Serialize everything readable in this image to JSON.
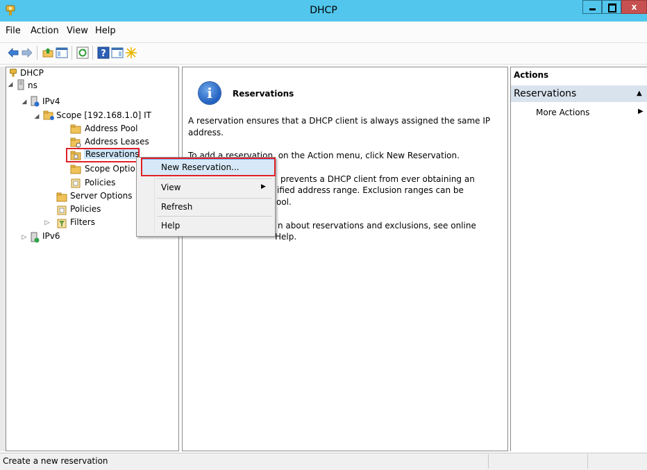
{
  "window": {
    "title": "DHCP"
  },
  "menubar": {
    "items": [
      "File",
      "Action",
      "View",
      "Help"
    ]
  },
  "tree": {
    "root": "DHCP",
    "server": "ns",
    "ipv4": "IPv4",
    "scope": "Scope [192.168.1.0] IT",
    "address_pool": "Address Pool",
    "address_leases": "Address Leases",
    "reservations": "Reservations",
    "scope_options": "Scope Optio",
    "scope_policies": "Policies",
    "server_options": "Server Options",
    "policies": "Policies",
    "filters": "Filters",
    "ipv6": "IPv6"
  },
  "context_menu": {
    "items": [
      "New Reservation...",
      "View",
      "Refresh",
      "Help"
    ]
  },
  "result": {
    "heading": "Reservations",
    "p1_line1": "A reservation ensures that a DHCP client is always assigned the same IP",
    "p1_line2": "address.",
    "p2_line1": "To add a reservation, on the Action menu, click New Reservation.",
    "p3_line1": "prevents a DHCP client from ever obtaining an",
    "p3_line2": "ified address range.  Exclusion ranges can be",
    "p3_line3": "ool.",
    "p4_line1": "n about reservations and exclusions, see online",
    "p4_line2": "Help."
  },
  "actions": {
    "header": "Actions",
    "section": "Reservations",
    "more": "More Actions"
  },
  "status": {
    "text": "Create a new reservation"
  },
  "colors": {
    "titlebar": "#52c6ec",
    "highlight": "#e01f26",
    "hover": "#d7e9f8",
    "actions_section": "#d9e3ee"
  }
}
